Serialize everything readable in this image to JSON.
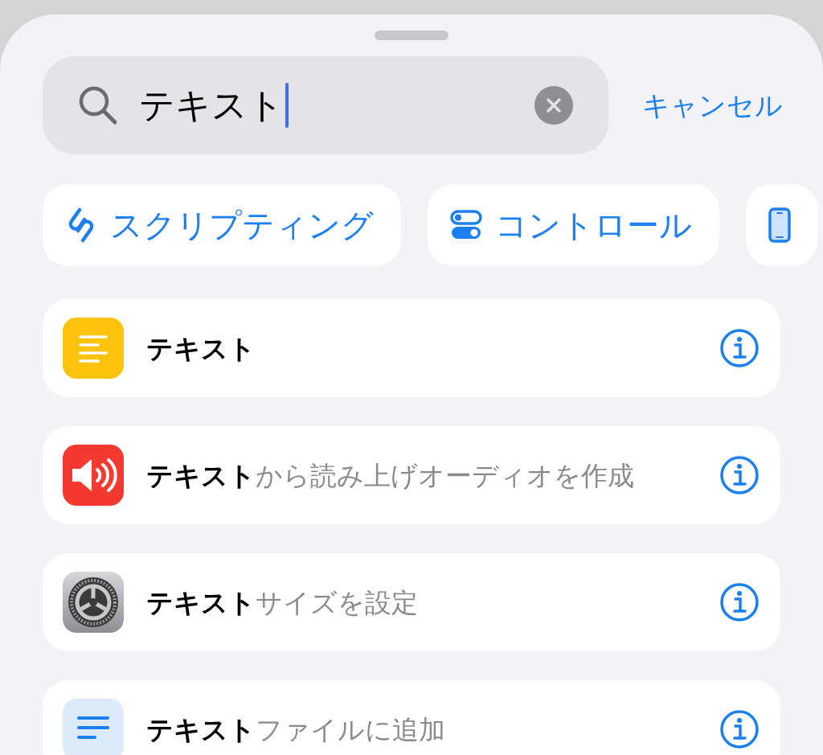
{
  "search": {
    "value": "テキスト",
    "cancel": "キャンセル"
  },
  "categories": [
    {
      "kind": "scripting",
      "label": "スクリプティング"
    },
    {
      "kind": "controls",
      "label": "コントロール"
    },
    {
      "kind": "device"
    }
  ],
  "results": [
    {
      "kind": "text",
      "title": "**テキスト**"
    },
    {
      "kind": "speaker",
      "title": "**テキスト**から読み上げオーディオを作成"
    },
    {
      "kind": "gear",
      "title": "**テキスト**サイズを設定"
    },
    {
      "kind": "list",
      "title": "**テキスト**ファイルに追加"
    }
  ]
}
